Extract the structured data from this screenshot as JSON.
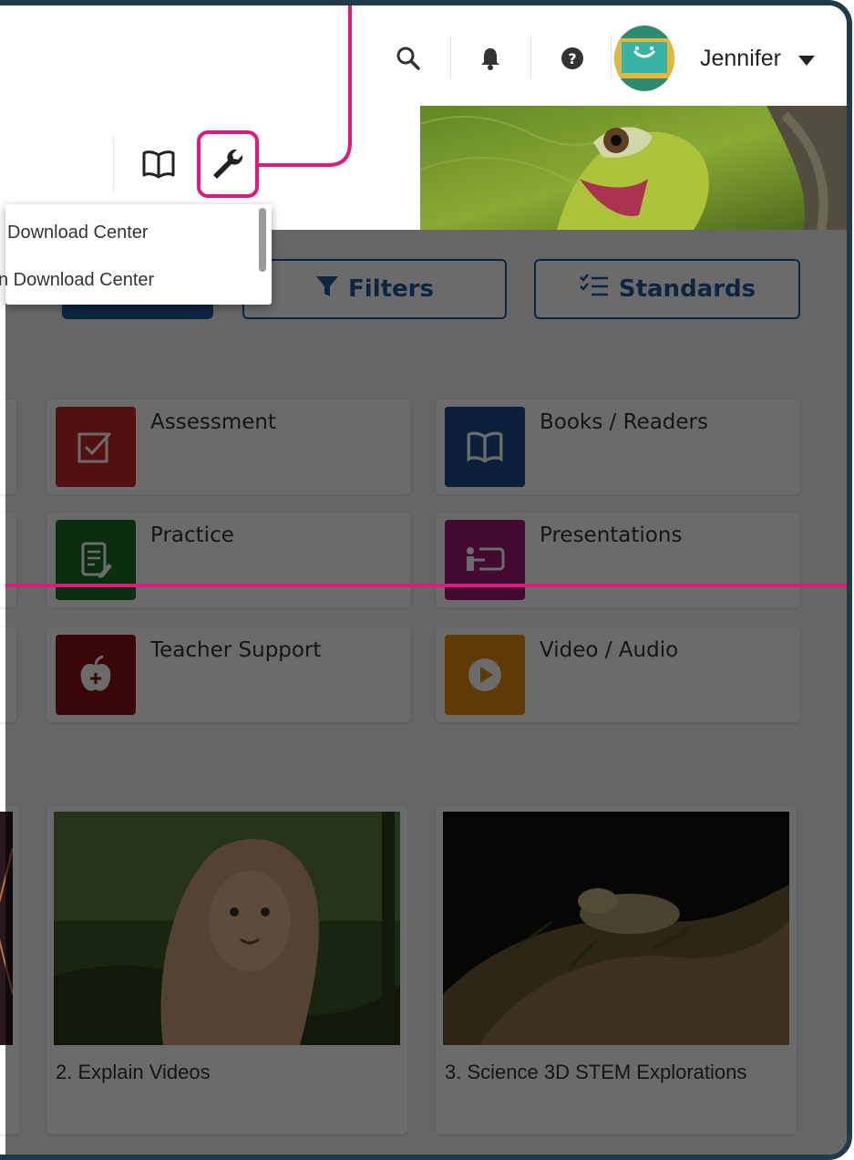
{
  "header": {
    "user_name": "Jennifer",
    "icons": [
      "search-icon",
      "bell-icon",
      "help-icon",
      "caret-down-icon"
    ]
  },
  "program_bar": {
    "icons": [
      "book-icon",
      "wrench-icon"
    ]
  },
  "dropdown": {
    "items": [
      "Download Center",
      "n Download Center"
    ]
  },
  "toolbar": {
    "filters_label": "Filters",
    "standards_label": "Standards"
  },
  "categories": [
    {
      "label": "Assessment",
      "icon": "checkbox-icon",
      "color": "#c62828"
    },
    {
      "label": "Books / Readers",
      "icon": "book-icon",
      "color": "#1f4e8c"
    },
    {
      "label": "Practice",
      "icon": "edit-document-icon",
      "color": "#1b6e2a"
    },
    {
      "label": "Presentations",
      "icon": "presenter-icon",
      "color": "#a0166e"
    },
    {
      "label": "Teacher Support",
      "icon": "apple-icon",
      "color": "#8b0f14"
    },
    {
      "label": "Video / Audio",
      "icon": "play-icon",
      "color": "#e58a0e"
    }
  ],
  "videos": [
    {
      "label": "2. Explain Videos"
    },
    {
      "label": "3. Science 3D STEM Explorations"
    }
  ],
  "colors": {
    "annotation": "#e0197d",
    "primary": "#1e5a9c",
    "frame": "#1f3a4a"
  }
}
